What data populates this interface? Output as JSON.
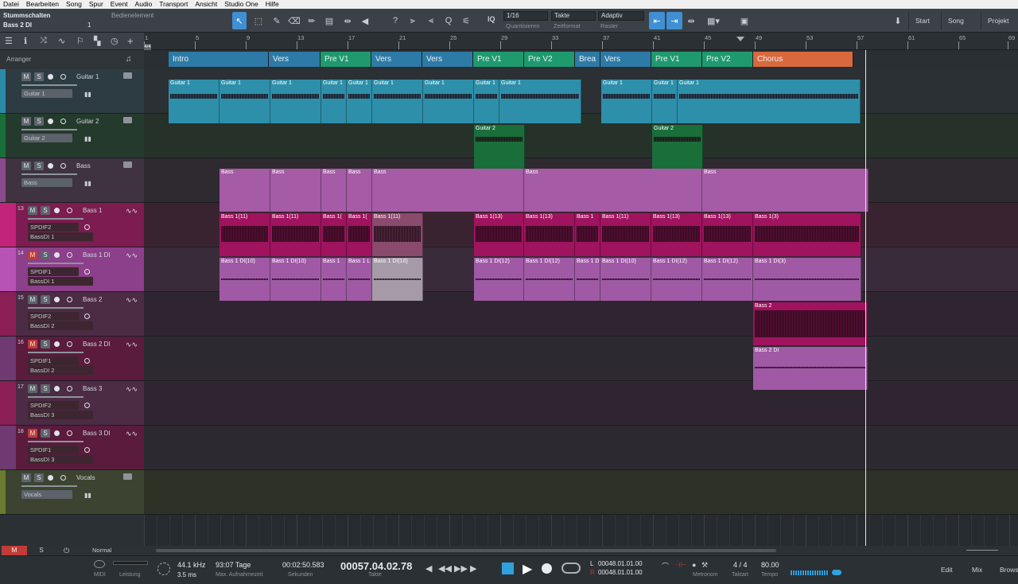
{
  "menu": [
    "Datei",
    "Bearbeiten",
    "Song",
    "Spur",
    "Event",
    "Audio",
    "Transport",
    "Ansicht",
    "Studio One",
    "Hilfe"
  ],
  "toolbar": {
    "mute_label": "Stummschalten",
    "control_label": "Bedienelement",
    "selected_track": "Bass 2 DI",
    "selected_num": "1",
    "quantize": "1/16",
    "quantize_sub": "Quantisieren",
    "timeformat": "Takte",
    "timeformat_sub": "Zeitformat",
    "snap": "Adaptiv",
    "snap_sub": "Raster",
    "iq": "IQ"
  },
  "right_tabs": [
    "Start",
    "Song",
    "Projekt"
  ],
  "arranger_label": "Arranger",
  "ruler": [
    "1",
    "5",
    "9",
    "13",
    "17",
    "21",
    "25",
    "29",
    "33",
    "37",
    "41",
    "45",
    "49",
    "53",
    "57",
    "61",
    "65",
    "69"
  ],
  "sections": [
    {
      "n": "Intro",
      "c": "#2e7aa6"
    },
    {
      "n": "Vers",
      "c": "#2e7aa6"
    },
    {
      "n": "Pre V1",
      "c": "#1f9a6e"
    },
    {
      "n": "Vers",
      "c": "#2e7aa6"
    },
    {
      "n": "Vers",
      "c": "#2e7aa6"
    },
    {
      "n": "Pre V1",
      "c": "#1f9a6e"
    },
    {
      "n": "Pre V2",
      "c": "#1f9a6e"
    },
    {
      "n": "Brea",
      "c": "#2e7aa6"
    },
    {
      "n": "Vers",
      "c": "#2e7aa6"
    },
    {
      "n": "Pre V1",
      "c": "#1f9a6e"
    },
    {
      "n": "Pre V2",
      "c": "#1f9a6e"
    },
    {
      "n": "Chorus",
      "c": "#d9693c"
    }
  ],
  "tracks": [
    {
      "name": "Guitar 1",
      "sel": "Guitar 1",
      "num": "",
      "color": "#2a8aa8"
    },
    {
      "name": "Guitar 2",
      "sel": "Guitar 2",
      "num": "",
      "color": "#1a6e3a"
    },
    {
      "name": "Bass",
      "sel": "Bass",
      "num": "",
      "color": "#8b4a8e"
    },
    {
      "name": "Bass 1",
      "sel": "SPDIF2",
      "sub": "BassDI 1",
      "num": "13",
      "color": "#c2247a"
    },
    {
      "name": "Bass 1 DI",
      "sel": "SPDIF1",
      "sub": "BassDI 1",
      "num": "14",
      "color": "#b653b5"
    },
    {
      "name": "Bass 2",
      "sel": "SPDIF2",
      "sub": "BassDI 2",
      "num": "15",
      "color": "#8a1f55"
    },
    {
      "name": "Bass 2 DI",
      "sel": "SPDIF1",
      "sub": "BassDI 2",
      "num": "16",
      "color": "#6f3a71"
    },
    {
      "name": "Bass 3",
      "sel": "SPDIF2",
      "sub": "BassDI 3",
      "num": "17",
      "color": "#8a1f55"
    },
    {
      "name": "Bass 3 DI",
      "sel": "SPDIF1",
      "sub": "BassDI 3",
      "num": "18",
      "color": "#6f3a71"
    },
    {
      "name": "Vocals",
      "sel": "Vocals",
      "num": "",
      "color": "#6a7a2e"
    }
  ],
  "ms": {
    "m": "M",
    "s": "S"
  },
  "events": {
    "g1": [
      "Guitar 1",
      "Guitar 1",
      "Guitar 1",
      "Guitar 1",
      "Guitar 1",
      "Guitar 1",
      "Guitar 1",
      "Guitar 1",
      "Guitar 1",
      "Guitar 1",
      "Guitar 1",
      "Guitar 1"
    ],
    "g2": [
      "Guitar 2",
      "Guitar 2"
    ],
    "bass": [
      "Bass",
      "Bass",
      "Bass",
      "Bass",
      "Bass",
      "Bass",
      "Bass"
    ],
    "b1": [
      "Bass 1(11)",
      "Bass 1(11)",
      "Bass 1(",
      "Bass 1(",
      "Bass 1(11)",
      "Bass 1(13)",
      "Bass 1(13)",
      "Bass 1",
      "Bass 1(11)",
      "Bass 1(13)",
      "Bass 1(13)",
      "Bass 1(3)"
    ],
    "b1di": [
      "Bass 1 DI(10)",
      "Bass 1 DI(10)",
      "Bass 1",
      "Bass 1 L",
      "Bass 1 DI(10)",
      "Bass 1 DI(12)",
      "Bass 1 DI(12)",
      "Bass 1 DI(12)",
      "Bass 1 DI(10)",
      "Bass 1 DI(12)",
      "Bass 1 DI(12)",
      "Bass 1 DI(3)"
    ],
    "b2": "Bass 2",
    "b2di": "Bass 2 DI"
  },
  "bottom": {
    "m": "M",
    "s": "S",
    "mode": "Normal"
  },
  "transport": {
    "midi": "MIDI",
    "perf": "Leistung",
    "rate": "44.1 kHz",
    "lat": "3.5 ms",
    "rec": "93:07 Tage",
    "rec_l": "Max. Aufnahmezeit",
    "sec": "00:02:50.583",
    "sec_l": "Sekunden",
    "bars": "00057.04.02.78",
    "bars_l": "Takte",
    "L": "00048.01.01.00",
    "R": "00048.01.01.00",
    "metro": "Metronom",
    "sig": "4 / 4",
    "sig_l": "Taktart",
    "tempo": "80.00",
    "tempo_l": "Tempo",
    "views": [
      "Edit",
      "Mix",
      "Browse"
    ]
  }
}
